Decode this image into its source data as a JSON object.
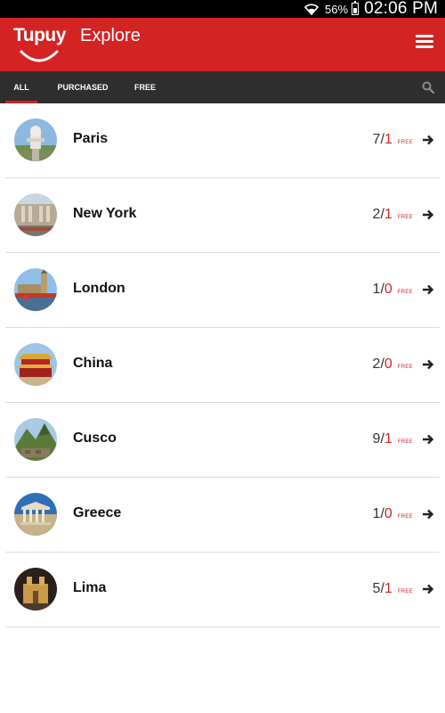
{
  "status": {
    "battery": "56%",
    "time": "02:06 PM"
  },
  "appbar": {
    "brand": "Tupuy",
    "title": "Explore"
  },
  "tabs": [
    {
      "label": "ALL",
      "active": true
    },
    {
      "label": "PURCHASED",
      "active": false
    },
    {
      "label": "FREE",
      "active": false
    }
  ],
  "free_tag": "FREE",
  "colors": {
    "accent": "#d32423",
    "tabbar": "#2e2e2e"
  },
  "cities": [
    {
      "name": "Paris",
      "total": "7",
      "free": "1",
      "thumb": "paris-thumb"
    },
    {
      "name": "New York",
      "total": "2",
      "free": "1",
      "thumb": "newyork-thumb"
    },
    {
      "name": "London",
      "total": "1",
      "free": "0",
      "thumb": "london-thumb"
    },
    {
      "name": "China",
      "total": "2",
      "free": "0",
      "thumb": "china-thumb"
    },
    {
      "name": "Cusco",
      "total": "9",
      "free": "1",
      "thumb": "cusco-thumb"
    },
    {
      "name": "Greece",
      "total": "1",
      "free": "0",
      "thumb": "greece-thumb"
    },
    {
      "name": "Lima",
      "total": "5",
      "free": "1",
      "thumb": "lima-thumb"
    }
  ]
}
